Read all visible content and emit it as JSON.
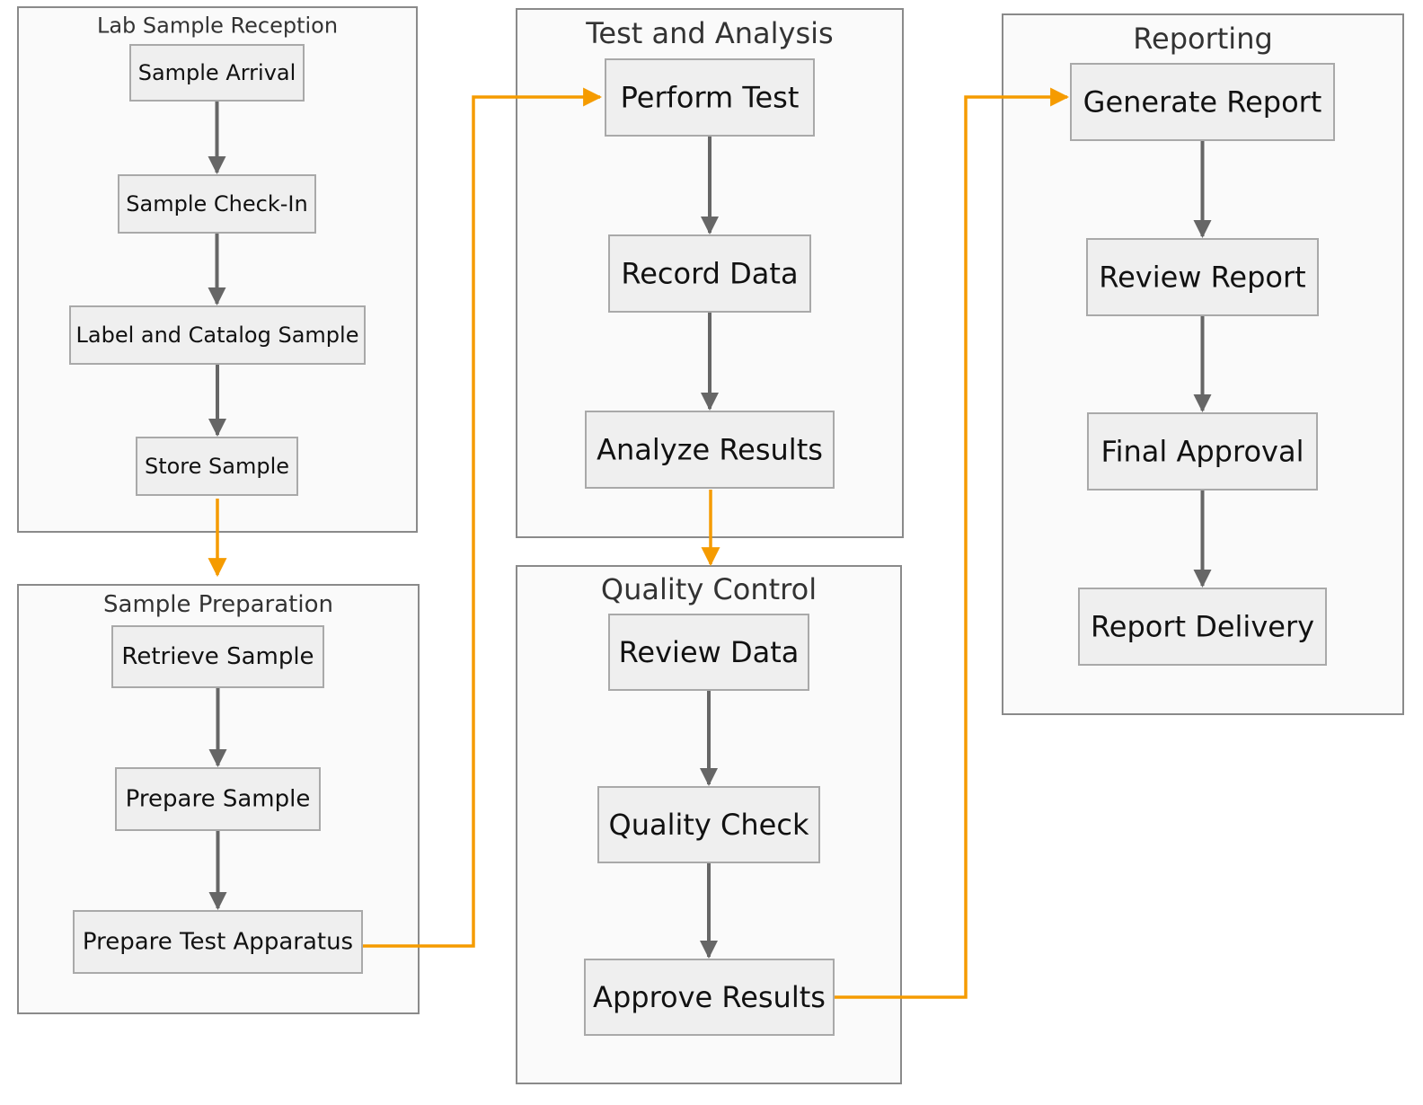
{
  "diagram": {
    "clusters": [
      {
        "id": "reception",
        "title": "Lab Sample Reception"
      },
      {
        "id": "preparation",
        "title": "Sample Preparation"
      },
      {
        "id": "testing",
        "title": "Test and Analysis"
      },
      {
        "id": "qc",
        "title": "Quality Control"
      },
      {
        "id": "reporting",
        "title": "Reporting"
      }
    ],
    "nodes": [
      {
        "id": "arrival",
        "label": "Sample Arrival",
        "cluster": "reception"
      },
      {
        "id": "checkin",
        "label": "Sample Check-In",
        "cluster": "reception"
      },
      {
        "id": "catalog",
        "label": "Label and Catalog Sample",
        "cluster": "reception"
      },
      {
        "id": "store",
        "label": "Store Sample",
        "cluster": "reception"
      },
      {
        "id": "retrieve",
        "label": "Retrieve Sample",
        "cluster": "preparation"
      },
      {
        "id": "prepare",
        "label": "Prepare Sample",
        "cluster": "preparation"
      },
      {
        "id": "apparatus",
        "label": "Prepare Test Apparatus",
        "cluster": "preparation"
      },
      {
        "id": "perform",
        "label": "Perform Test",
        "cluster": "testing"
      },
      {
        "id": "record",
        "label": "Record Data",
        "cluster": "testing"
      },
      {
        "id": "analyze",
        "label": "Analyze Results",
        "cluster": "testing"
      },
      {
        "id": "reviewdata",
        "label": "Review Data",
        "cluster": "qc"
      },
      {
        "id": "qcheck",
        "label": "Quality Check",
        "cluster": "qc"
      },
      {
        "id": "approve",
        "label": "Approve Results",
        "cluster": "qc"
      },
      {
        "id": "generate",
        "label": "Generate Report",
        "cluster": "reporting"
      },
      {
        "id": "reviewreport",
        "label": "Review Report",
        "cluster": "reporting"
      },
      {
        "id": "final",
        "label": "Final Approval",
        "cluster": "reporting"
      },
      {
        "id": "delivery",
        "label": "Report Delivery",
        "cluster": "reporting"
      }
    ],
    "edges": [
      {
        "from": "arrival",
        "to": "checkin",
        "kind": "step"
      },
      {
        "from": "checkin",
        "to": "catalog",
        "kind": "step"
      },
      {
        "from": "catalog",
        "to": "store",
        "kind": "step"
      },
      {
        "from": "store",
        "to": "preparation",
        "kind": "handoff"
      },
      {
        "from": "retrieve",
        "to": "prepare",
        "kind": "step"
      },
      {
        "from": "prepare",
        "to": "apparatus",
        "kind": "step"
      },
      {
        "from": "apparatus",
        "to": "perform",
        "kind": "handoff"
      },
      {
        "from": "perform",
        "to": "record",
        "kind": "step"
      },
      {
        "from": "record",
        "to": "analyze",
        "kind": "step"
      },
      {
        "from": "analyze",
        "to": "qc",
        "kind": "handoff"
      },
      {
        "from": "reviewdata",
        "to": "qcheck",
        "kind": "step"
      },
      {
        "from": "qcheck",
        "to": "approve",
        "kind": "step"
      },
      {
        "from": "approve",
        "to": "generate",
        "kind": "handoff"
      },
      {
        "from": "generate",
        "to": "reviewreport",
        "kind": "step"
      },
      {
        "from": "reviewreport",
        "to": "final",
        "kind": "step"
      },
      {
        "from": "final",
        "to": "delivery",
        "kind": "step"
      }
    ],
    "colors": {
      "step": "#666666",
      "handoff": "#f59b00",
      "node_fill": "#efefef",
      "cluster_fill": "#fafafa"
    }
  }
}
